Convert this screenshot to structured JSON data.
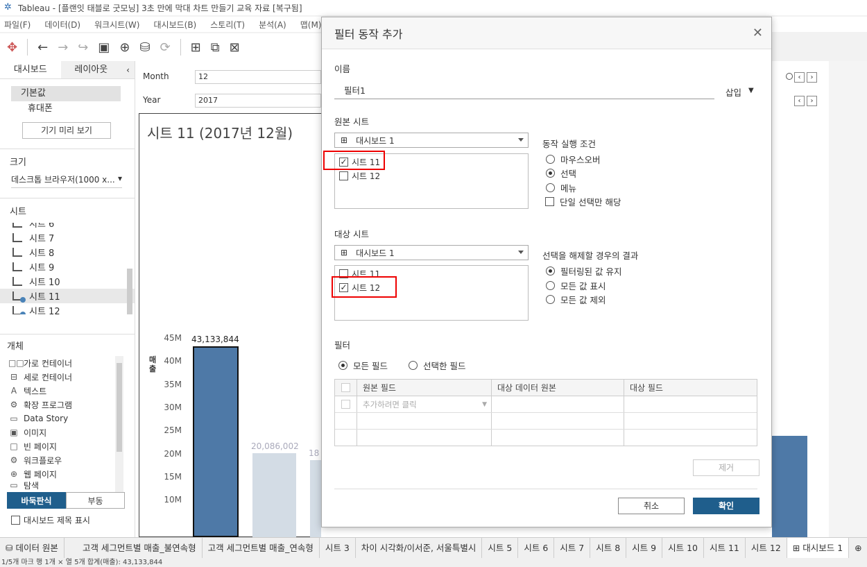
{
  "window": {
    "title": "Tableau - [플랜잇 태블로 굿모닝] 3초 만에 막대 차트 만들기 교육 자료 [복구됨]"
  },
  "menu": [
    "파일(F)",
    "데이터(D)",
    "워크시트(W)",
    "대시보드(B)",
    "스토리(T)",
    "분석(A)",
    "맵(M)"
  ],
  "left_panel": {
    "tabs": [
      "대시보드",
      "레이아웃"
    ],
    "device_default": "기본값",
    "device_phone": "휴대폰",
    "preview_button": "기기 미리 보기",
    "size_label": "크기",
    "size_value": "데스크톱 브라우저(1000 x...",
    "sheets_label": "시트",
    "sheets": [
      "시트 6",
      "시트 7",
      "시트 8",
      "시트 9",
      "시트 10",
      "시트 11",
      "시트 12"
    ],
    "objects_label": "개체",
    "objects": [
      {
        "icon": "□□",
        "label": "가로 컨테이너"
      },
      {
        "icon": "⊟",
        "label": "세로 컨테이너"
      },
      {
        "icon": "A",
        "label": "텍스트"
      },
      {
        "icon": "⚙",
        "label": "확장 프로그램"
      },
      {
        "icon": "▭",
        "label": "Data Story"
      },
      {
        "icon": "▣",
        "label": "이미지"
      },
      {
        "icon": "□",
        "label": "빈 페이지"
      },
      {
        "icon": "⚙",
        "label": "워크플로우"
      },
      {
        "icon": "⊕",
        "label": "웹 페이지"
      },
      {
        "icon": "▭",
        "label": "탐색"
      }
    ],
    "tiled": "바둑판식",
    "floating": "부동",
    "show_title": "대시보드 제목 표시"
  },
  "filters": {
    "month_label": "Month",
    "month_value": "12",
    "year_label": "Year",
    "year_value": "2017"
  },
  "chart_data": {
    "type": "bar",
    "title": "시트 11 (2017년 12월)",
    "ylabel": "매출",
    "yticks": [
      "45M",
      "40M",
      "35M",
      "30M",
      "25M",
      "20M",
      "15M",
      "10M"
    ],
    "bars": [
      {
        "value": 43133844,
        "label": "43,133,844",
        "highlight": true
      },
      {
        "value": 20086002,
        "label": "20,086,002",
        "highlight": false
      },
      {
        "value": 18600000,
        "label": "18",
        "highlight": false
      }
    ]
  },
  "dialog": {
    "title": "필터 동작 추가",
    "name_label": "이름",
    "name_value": "필터1",
    "insert_label": "삽입",
    "source_label": "원본 시트",
    "source_dashboard": "대시보드 1",
    "source_sheets": [
      {
        "label": "시트 11",
        "checked": true
      },
      {
        "label": "시트 12",
        "checked": false
      }
    ],
    "run_on_label": "동작 실행 조건",
    "run_on_options": [
      {
        "label": "마우스오버",
        "selected": false
      },
      {
        "label": "선택",
        "selected": true
      },
      {
        "label": "메뉴",
        "selected": false
      }
    ],
    "single_select_label": "단일 선택만 해당",
    "target_label": "대상 시트",
    "target_dashboard": "대시보드 1",
    "target_sheets": [
      {
        "label": "시트 11",
        "checked": false
      },
      {
        "label": "시트 12",
        "checked": true
      }
    ],
    "clear_label": "선택을 해제할 경우의 결과",
    "clear_options": [
      {
        "label": "필터링된 값 유지",
        "selected": true
      },
      {
        "label": "모든 값 표시",
        "selected": false
      },
      {
        "label": "모든 값 제외",
        "selected": false
      }
    ],
    "filter_label": "필터",
    "all_fields": "모든 필드",
    "selected_fields": "선택한 필드",
    "grid_headers": [
      "원본 필드",
      "대상 데이터 원본",
      "대상 필드"
    ],
    "grid_placeholder": "추가하려면 클릭",
    "remove_button": "제거",
    "cancel_button": "취소",
    "ok_button": "확인"
  },
  "bottom_tabs": [
    "데이터 원본",
    "고객 세그먼트별 매출_불연속형",
    "고객 세그먼트별 매출_연속형",
    "시트 3",
    "차이 시각화/이서준, 서울특별시",
    "시트 5",
    "시트 6",
    "시트 7",
    "시트 8",
    "시트 9",
    "시트 10",
    "시트 11",
    "시트 12",
    "대시보드 1"
  ],
  "status": "1/5개 마크    행 1개 × 열 5개    합계(매출): 43,133,844",
  "colors": {
    "accent": "#1f5e8c",
    "bar_dark": "#4e79a7",
    "bar_light": "#d3dce5",
    "highlight_box": "#e00000"
  }
}
